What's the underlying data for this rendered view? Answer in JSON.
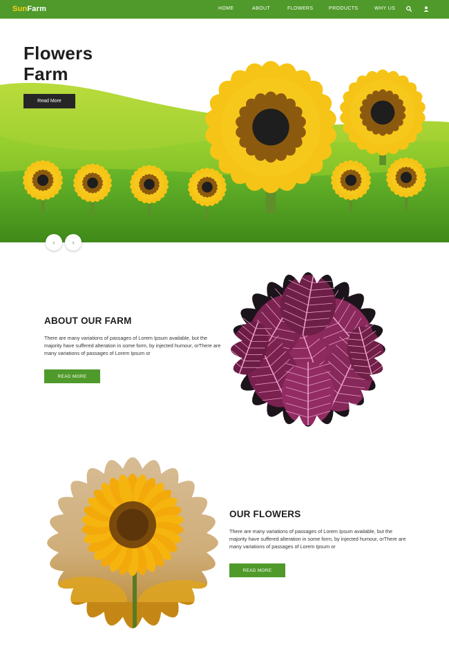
{
  "nav": {
    "logo_part1": "Sun",
    "logo_part2": "Farm",
    "items": [
      "HOME",
      "ABOUT",
      "FLOWERS",
      "PRODUCTS",
      "WHY US"
    ],
    "icons": [
      "search-icon",
      "user-icon"
    ]
  },
  "hero": {
    "title_line1": "Flowers",
    "title_line2": "Farm",
    "button": "Read More",
    "prev": "‹",
    "next": "›"
  },
  "about": {
    "title": "ABOUT OUR FARM",
    "text": "There are many variations of passages of Lorem Ipsum available, but the majority have suffered alteration in some form, by injected humour, orThere are many variations of passages of Lorem Ipsum or",
    "button": "READ MORE"
  },
  "flowers": {
    "title": "OUR FLOWERS",
    "text": "There are many variations of passages of Lorem Ipsum available, but the majority have suffered alteration in some form, by injected humour, orThere are many variations of passages of Lorem Ipsum or",
    "button": "READ MORE"
  },
  "colors": {
    "brand_green": "#4f9a2a",
    "logo_yellow": "#ffd21a",
    "dark_button": "#262626"
  }
}
